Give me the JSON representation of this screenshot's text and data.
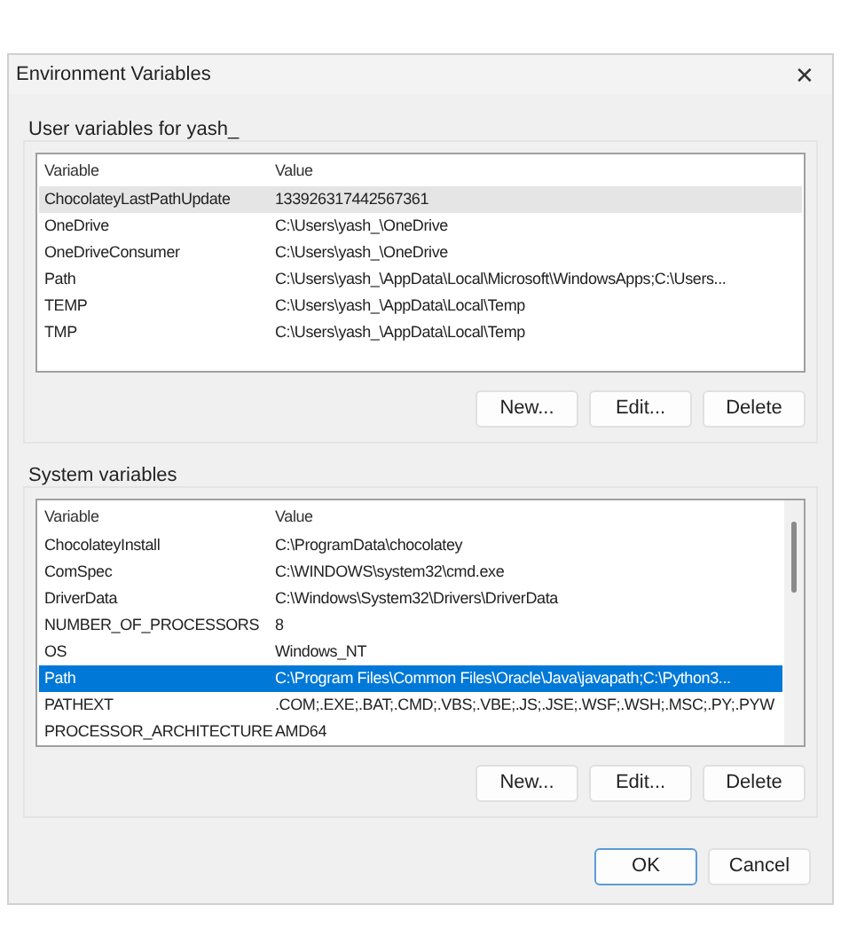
{
  "window": {
    "title": "Environment Variables",
    "close": "✕"
  },
  "groups": [
    {
      "label": "User variables for yash_",
      "focused": false,
      "scrollbar": false,
      "columns": [
        "Variable",
        "Value"
      ],
      "rows": [
        {
          "cells": [
            "ChocolateyLastPathUpdate",
            "133926317442567361"
          ],
          "selected": true
        },
        {
          "cells": [
            "OneDrive",
            "C:\\Users\\yash_\\OneDrive"
          ],
          "selected": false
        },
        {
          "cells": [
            "OneDriveConsumer",
            "C:\\Users\\yash_\\OneDrive"
          ],
          "selected": false
        },
        {
          "cells": [
            "Path",
            "C:\\Users\\yash_\\AppData\\Local\\Microsoft\\WindowsApps;C:\\Users..."
          ],
          "selected": false
        },
        {
          "cells": [
            "TEMP",
            "C:\\Users\\yash_\\AppData\\Local\\Temp"
          ],
          "selected": false
        },
        {
          "cells": [
            "TMP",
            "C:\\Users\\yash_\\AppData\\Local\\Temp"
          ],
          "selected": false
        }
      ],
      "buttons": [
        "New...",
        "Edit...",
        "Delete"
      ]
    },
    {
      "label": "System variables",
      "focused": true,
      "scrollbar": true,
      "columns": [
        "Variable",
        "Value"
      ],
      "rows": [
        {
          "cells": [
            "ChocolateyInstall",
            "C:\\ProgramData\\chocolatey"
          ],
          "selected": false
        },
        {
          "cells": [
            "ComSpec",
            "C:\\WINDOWS\\system32\\cmd.exe"
          ],
          "selected": false
        },
        {
          "cells": [
            "DriverData",
            "C:\\Windows\\System32\\Drivers\\DriverData"
          ],
          "selected": false
        },
        {
          "cells": [
            "NUMBER_OF_PROCESSORS",
            "8"
          ],
          "selected": false
        },
        {
          "cells": [
            "OS",
            "Windows_NT"
          ],
          "selected": false
        },
        {
          "cells": [
            "Path",
            "C:\\Program Files\\Common Files\\Oracle\\Java\\javapath;C:\\Python3..."
          ],
          "selected": true
        },
        {
          "cells": [
            "PATHEXT",
            ".COM;.EXE;.BAT;.CMD;.VBS;.VBE;.JS;.JSE;.WSF;.WSH;.MSC;.PY;.PYW"
          ],
          "selected": false
        },
        {
          "cells": [
            "PROCESSOR_ARCHITECTURE",
            "AMD64"
          ],
          "selected": false
        }
      ],
      "buttons": [
        "New...",
        "Edit...",
        "Delete"
      ]
    }
  ],
  "footer_buttons": [
    {
      "label": "OK",
      "default": true
    },
    {
      "label": "Cancel",
      "default": false
    }
  ]
}
